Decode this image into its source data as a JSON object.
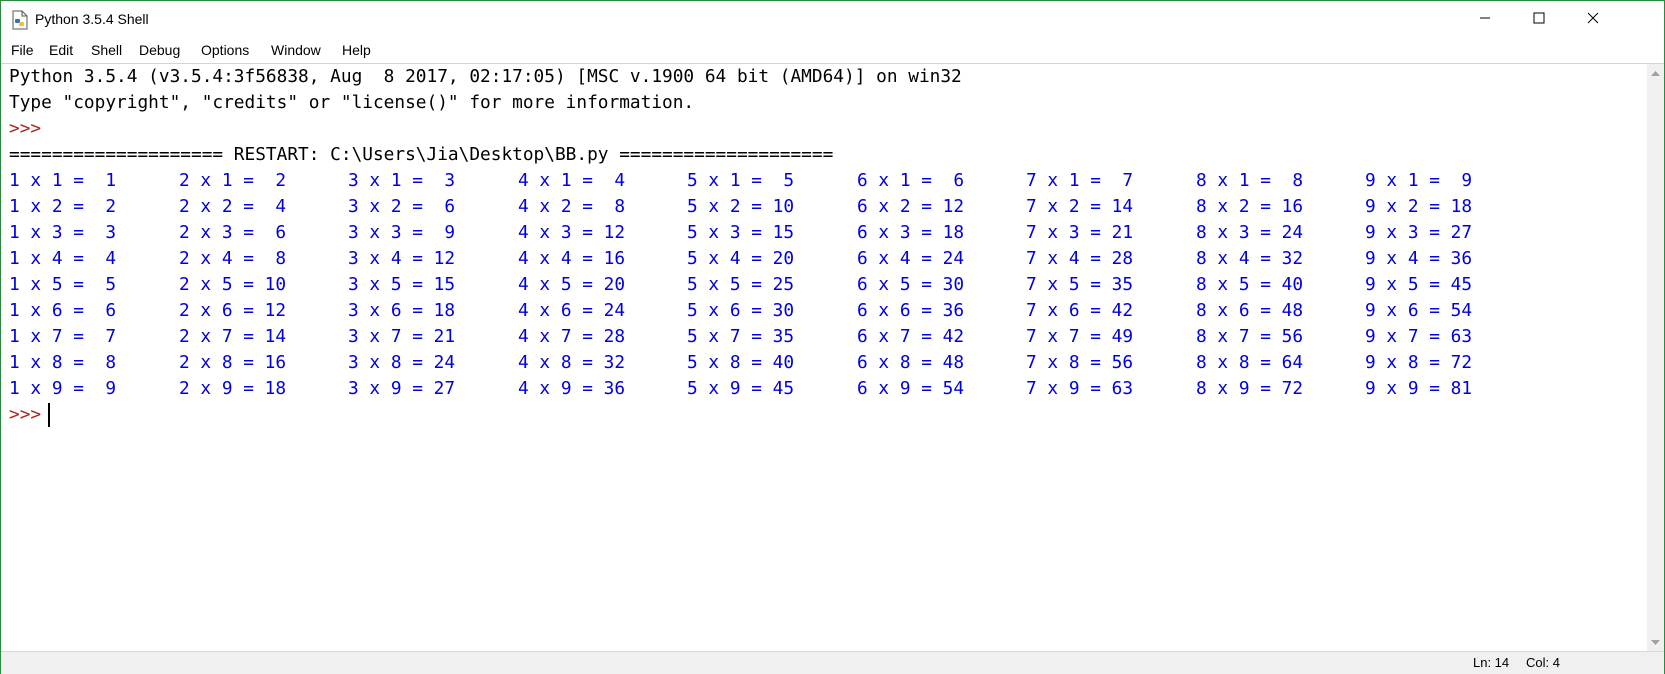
{
  "window": {
    "title": "Python 3.5.4 Shell"
  },
  "menu": [
    "File",
    "Edit",
    "Shell",
    "Debug",
    "Options",
    "Window",
    "Help"
  ],
  "shell": {
    "banner1": "Python 3.5.4 (v3.5.4:3f56838, Aug  8 2017, 02:17:05) [MSC v.1900 64 bit (AMD64)] on win32",
    "banner2": "Type \"copyright\", \"credits\" or \"license()\" for more information.",
    "prompt1": ">>>",
    "restart": "==================== RESTART: C:\\Users\\Jia\\Desktop\\BB.py ====================",
    "table": [
      [
        "1 x 1 =  1",
        "2 x 1 =  2",
        "3 x 1 =  3",
        "4 x 1 =  4",
        "5 x 1 =  5",
        "6 x 1 =  6",
        "7 x 1 =  7",
        "8 x 1 =  8",
        "9 x 1 =  9"
      ],
      [
        "1 x 2 =  2",
        "2 x 2 =  4",
        "3 x 2 =  6",
        "4 x 2 =  8",
        "5 x 2 = 10",
        "6 x 2 = 12",
        "7 x 2 = 14",
        "8 x 2 = 16",
        "9 x 2 = 18"
      ],
      [
        "1 x 3 =  3",
        "2 x 3 =  6",
        "3 x 3 =  9",
        "4 x 3 = 12",
        "5 x 3 = 15",
        "6 x 3 = 18",
        "7 x 3 = 21",
        "8 x 3 = 24",
        "9 x 3 = 27"
      ],
      [
        "1 x 4 =  4",
        "2 x 4 =  8",
        "3 x 4 = 12",
        "4 x 4 = 16",
        "5 x 4 = 20",
        "6 x 4 = 24",
        "7 x 4 = 28",
        "8 x 4 = 32",
        "9 x 4 = 36"
      ],
      [
        "1 x 5 =  5",
        "2 x 5 = 10",
        "3 x 5 = 15",
        "4 x 5 = 20",
        "5 x 5 = 25",
        "6 x 5 = 30",
        "7 x 5 = 35",
        "8 x 5 = 40",
        "9 x 5 = 45"
      ],
      [
        "1 x 6 =  6",
        "2 x 6 = 12",
        "3 x 6 = 18",
        "4 x 6 = 24",
        "5 x 6 = 30",
        "6 x 6 = 36",
        "7 x 6 = 42",
        "8 x 6 = 48",
        "9 x 6 = 54"
      ],
      [
        "1 x 7 =  7",
        "2 x 7 = 14",
        "3 x 7 = 21",
        "4 x 7 = 28",
        "5 x 7 = 35",
        "6 x 7 = 42",
        "7 x 7 = 49",
        "8 x 7 = 56",
        "9 x 7 = 63"
      ],
      [
        "1 x 8 =  8",
        "2 x 8 = 16",
        "3 x 8 = 24",
        "4 x 8 = 32",
        "5 x 8 = 40",
        "6 x 8 = 48",
        "7 x 8 = 56",
        "8 x 8 = 64",
        "9 x 8 = 72"
      ],
      [
        "1 x 9 =  9",
        "2 x 9 = 18",
        "3 x 9 = 27",
        "4 x 9 = 36",
        "5 x 9 = 45",
        "6 x 9 = 54",
        "7 x 9 = 63",
        "8 x 9 = 72",
        "9 x 9 = 81"
      ]
    ],
    "prompt2": ">>>"
  },
  "status": {
    "line": "Ln: 14",
    "col": "Col: 4"
  },
  "colors": {
    "prompt": "#b22222",
    "output": "#0000e0",
    "text": "#000000"
  },
  "icons": {
    "app": "python-idle-icon",
    "minimize": "minimize-icon",
    "maximize": "maximize-icon",
    "close": "close-icon"
  }
}
